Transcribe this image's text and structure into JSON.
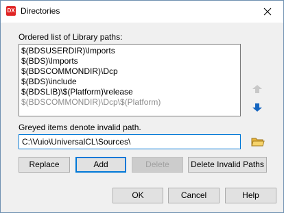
{
  "window": {
    "title": "Directories",
    "app_icon_text": "DX"
  },
  "list_label": "Ordered list of Library paths:",
  "paths": [
    {
      "text": "$(BDSUSERDIR)\\Imports",
      "valid": true
    },
    {
      "text": "$(BDS)\\Imports",
      "valid": true
    },
    {
      "text": "$(BDSCOMMONDIR)\\Dcp",
      "valid": true
    },
    {
      "text": "$(BDS)\\include",
      "valid": true
    },
    {
      "text": "$(BDSLIB)\\$(Platform)\\release",
      "valid": true
    },
    {
      "text": "$(BDSCOMMONDIR)\\Dcp\\$(Platform)",
      "valid": false
    }
  ],
  "hint_text": "Greyed items denote invalid path.",
  "path_input_value": "C:\\Vuio\\UniversalCL\\Sources\\",
  "buttons": {
    "replace": "Replace",
    "add": "Add",
    "delete": "Delete",
    "delete_invalid": "Delete Invalid Paths",
    "ok": "OK",
    "cancel": "Cancel",
    "help": "Help"
  },
  "colors": {
    "move_arrow_enabled": "#1565c0",
    "move_arrow_disabled": "#c8c8c8",
    "accent": "#0078d7"
  }
}
